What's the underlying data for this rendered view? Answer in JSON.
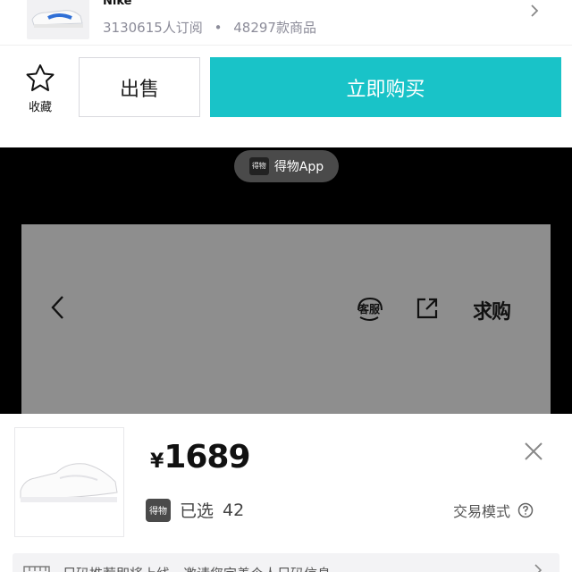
{
  "brand": {
    "name": "Nike",
    "subscribers": "3130615人订阅",
    "separator": "•",
    "product_count": "48297款商品"
  },
  "actions": {
    "favorite_label": "收藏",
    "sell_label": "出售",
    "buy_label": "立即购买"
  },
  "watermark": {
    "logo_text": "得物",
    "app_name": "得物App"
  },
  "product_nav": {
    "service_label": "客服",
    "wanted_label": "求购"
  },
  "sheet": {
    "currency": "¥",
    "price": "1689",
    "brand_logo": "得物",
    "selected_label": "已选",
    "selected_size": "42",
    "trade_mode_label": "交易模式",
    "size_banner_text": "尺码推荐即将上线，邀请您完善个人尺码信息"
  },
  "colors": {
    "accent": "#19c3c8",
    "overlay": "#8e8e8e",
    "black_band": "#000000"
  },
  "icons": [
    "star-icon",
    "chevron-right-icon",
    "back-icon",
    "headset-icon",
    "share-icon",
    "close-icon",
    "help-icon",
    "ruler-icon"
  ]
}
